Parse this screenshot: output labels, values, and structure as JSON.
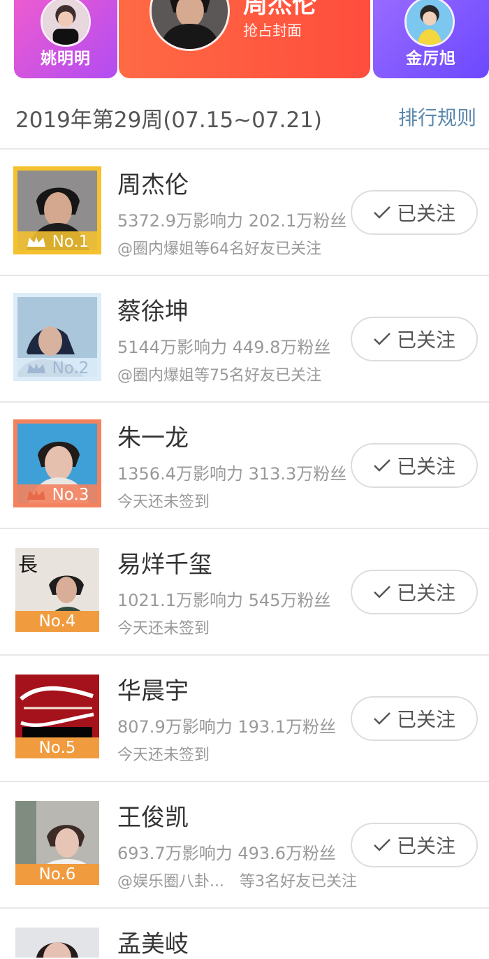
{
  "cover": {
    "left_name": "姚明明",
    "center_name": "周杰伦",
    "center_sub": "抢占封面",
    "right_name": "金厉旭"
  },
  "week": {
    "title": "2019年第29周(07.15~07.21)",
    "rules": "排行规则"
  },
  "colors": {
    "accent_blue": "#5a88ad",
    "follow_border": "#dddddd",
    "rank1": "#f5c12f",
    "rank2": "#dcecf8",
    "rank3": "#f3825f",
    "rank_other": "#f09b3e"
  },
  "list": [
    {
      "rank": "No.1",
      "name": "周杰伦",
      "stats": "5372.9万影响力 202.1万粉丝",
      "friends": "@圈内爆姐等64名好友已关注",
      "button": "已关注",
      "crown": true
    },
    {
      "rank": "No.2",
      "name": "蔡徐坤",
      "stats": "5144万影响力 449.8万粉丝",
      "friends": "@圈内爆姐等75名好友已关注",
      "button": "已关注",
      "crown": true
    },
    {
      "rank": "No.3",
      "name": "朱一龙",
      "stats": "1356.4万影响力 313.3万粉丝",
      "friends": "今天还未签到",
      "button": "已关注",
      "crown": true
    },
    {
      "rank": "No.4",
      "name": "易烊千玺",
      "stats": "1021.1万影响力 545万粉丝",
      "friends": "今天还未签到",
      "button": "已关注",
      "crown": false
    },
    {
      "rank": "No.5",
      "name": "华晨宇",
      "stats": "807.9万影响力 193.1万粉丝",
      "friends": "今天还未签到",
      "button": "已关注",
      "crown": false
    },
    {
      "rank": "No.6",
      "name": "王俊凯",
      "stats": "693.7万影响力 493.6万粉丝",
      "friends": "@娱乐圈八卦...　等3名好友已关注",
      "button": "已关注",
      "crown": false
    },
    {
      "rank": "",
      "name": "孟美岐",
      "stats": "",
      "friends": "",
      "button": "",
      "crown": false
    }
  ]
}
